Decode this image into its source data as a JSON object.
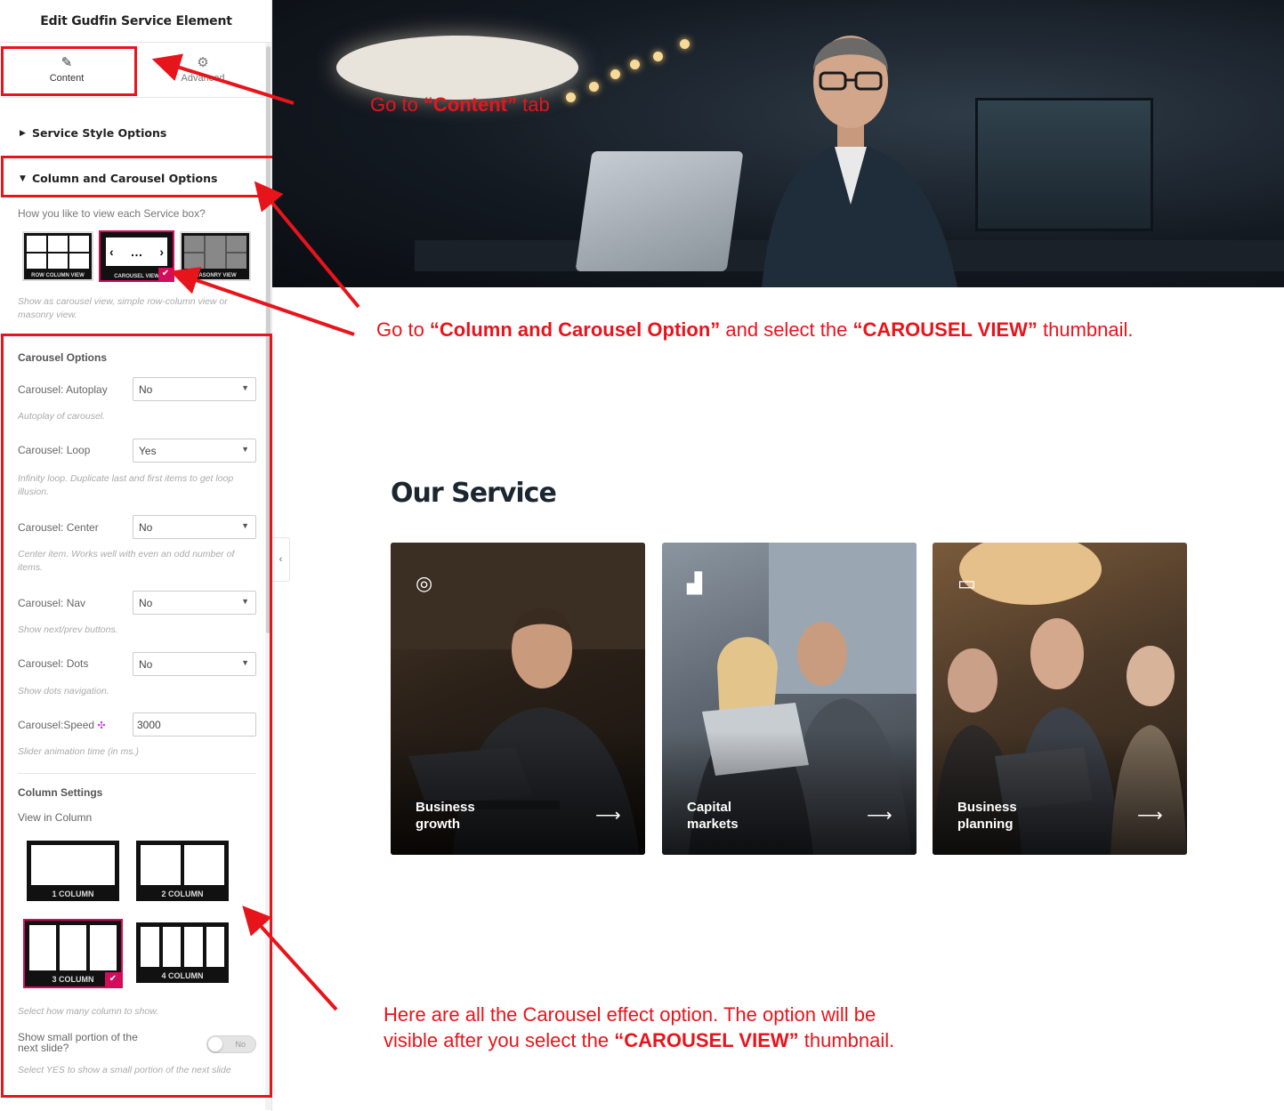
{
  "panel": {
    "title": "Edit Gudfin Service Element",
    "tabs": [
      {
        "label": "Content",
        "icon": "pencil-icon"
      },
      {
        "label": "Advanced",
        "icon": "gear-icon"
      }
    ],
    "sections": [
      {
        "label": "Service Style Options",
        "expanded": false
      },
      {
        "label": "Column and Carousel Options",
        "expanded": true
      }
    ],
    "view_question": "How you like to view each Service box?",
    "view_options": [
      {
        "caption": "ROW COLUMN VIEW",
        "selected": false
      },
      {
        "caption": "CAROUSEL VIEW",
        "selected": true
      },
      {
        "caption": "MASONRY VIEW",
        "selected": false
      }
    ],
    "view_help": "Show as carousel view, simple row-column view or masonry view.",
    "carousel": {
      "title": "Carousel Options",
      "controls": [
        {
          "label": "Carousel: Autoplay",
          "value": "No",
          "help": "Autoplay of carousel."
        },
        {
          "label": "Carousel: Loop",
          "value": "Yes",
          "help": "Infinity loop. Duplicate last and first items to get loop illusion."
        },
        {
          "label": "Carousel: Center",
          "value": "No",
          "help": "Center item. Works well with even an odd number of items."
        },
        {
          "label": "Carousel: Nav",
          "value": "No",
          "help": "Show next/prev buttons."
        },
        {
          "label": "Carousel: Dots",
          "value": "No",
          "help": "Show dots navigation."
        }
      ],
      "speed": {
        "label": "Carousel:Speed",
        "value": "3000",
        "help": "Slider animation time (in ms.)"
      }
    },
    "columns": {
      "title": "Column Settings",
      "subtitle": "View in Column",
      "options": [
        {
          "caption": "1 COLUMN",
          "count": 1,
          "selected": false
        },
        {
          "caption": "2 COLUMN",
          "count": 2,
          "selected": false
        },
        {
          "caption": "3 COLUMN",
          "count": 3,
          "selected": true
        },
        {
          "caption": "4 COLUMN",
          "count": 4,
          "selected": false
        }
      ],
      "help": "Select how many column to show."
    },
    "small_portion": {
      "label": "Show small portion of the next slide?",
      "toggle": "No",
      "help": "Select YES to show a small portion of the next slide"
    },
    "collapse_icon": "chevron-left-icon"
  },
  "annotations": {
    "content_tab": {
      "pre": "Go  to ",
      "bold": "“Content”",
      "post": " tab"
    },
    "column_option": {
      "pre": "Go to ",
      "bold1": "“Column and Carousel Option”",
      "mid": " and select the ",
      "bold2": "“CAROUSEL VIEW”",
      "post": " thumbnail."
    },
    "carousel_effects": {
      "line1": "Here are all the Carousel effect option. The option will be",
      "line2_pre": "visible after you select the ",
      "line2_bold": "“CAROUSEL VIEW”",
      "line2_post": " thumbnail."
    }
  },
  "service": {
    "title": "Our Service",
    "cards": [
      {
        "label_line1": "Business",
        "label_line2": "growth",
        "icon": "coins-icon"
      },
      {
        "label_line1": "Capital",
        "label_line2": "markets",
        "icon": "bar-chart-icon"
      },
      {
        "label_line1": "Business",
        "label_line2": "planning",
        "icon": "wallet-icon"
      }
    ]
  },
  "colors": {
    "accent": "#d30c5c",
    "annotation": "#e8141b",
    "heading": "#1c2630"
  }
}
